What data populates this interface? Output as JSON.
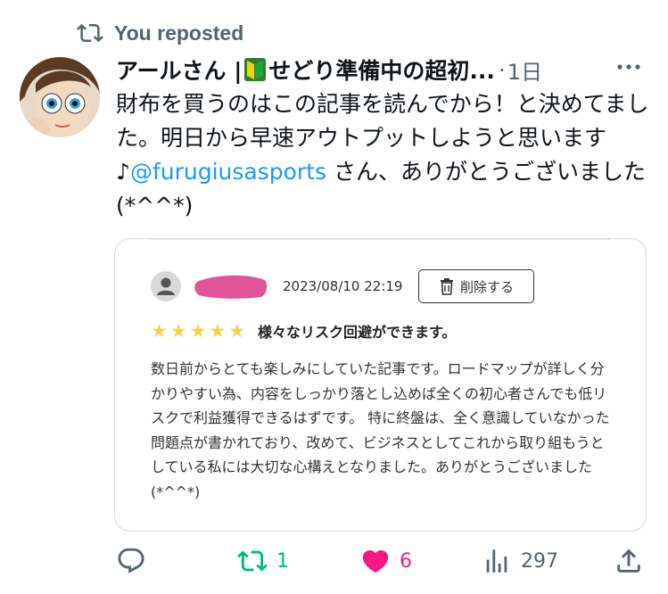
{
  "repost": {
    "label": "You reposted",
    "icon": "repost-icon"
  },
  "post": {
    "author": {
      "name_part1": "アールさん |",
      "name_part2": "せどり準備中の超初...",
      "badge_icon": "beginner-leaf-icon"
    },
    "separator": "·",
    "time": "1日",
    "more_icon": "more-icon",
    "text_before_mention": "財布を買うのはこの記事を読んでから！と決めてました。明日から早速アウトプットしようと思います♪",
    "mention": "@furugiusasports",
    "text_after_mention": " さん、ありがとうございました (*^^*)"
  },
  "review_card": {
    "date": "2023/08/10 22:19",
    "delete_label": "削除する",
    "rating": 5,
    "stars": [
      "★",
      "★",
      "★",
      "★",
      "★"
    ],
    "title": "様々なリスク回避ができます。",
    "body": "数日前からとても楽しみにしていた記事です。ロードマップが詳しく分かりやすい為、内容をしっかり落とし込めば全くの初心者さんでも低リスクで利益獲得できるはずです。 特に終盤は、全く意識していなかった問題点が書かれており、改めて、ビジネスとしてこれから取り組もうとしている私には大切な心構えとなりました。ありがとうございました(*^^*)"
  },
  "actions": {
    "reply": {
      "icon": "reply-icon",
      "count": ""
    },
    "repost": {
      "icon": "repost-icon",
      "count": "1"
    },
    "like": {
      "icon": "heart-icon",
      "count": "6"
    },
    "views": {
      "icon": "views-icon",
      "count": "297"
    },
    "share": {
      "icon": "share-icon",
      "count": ""
    }
  },
  "colors": {
    "repost_active": "#00ba7c",
    "like_active": "#f91880",
    "mention": "#1d9bf0",
    "secondary_text": "#536471",
    "star": "#f5d24a",
    "censor_blob": "#e0559a"
  }
}
